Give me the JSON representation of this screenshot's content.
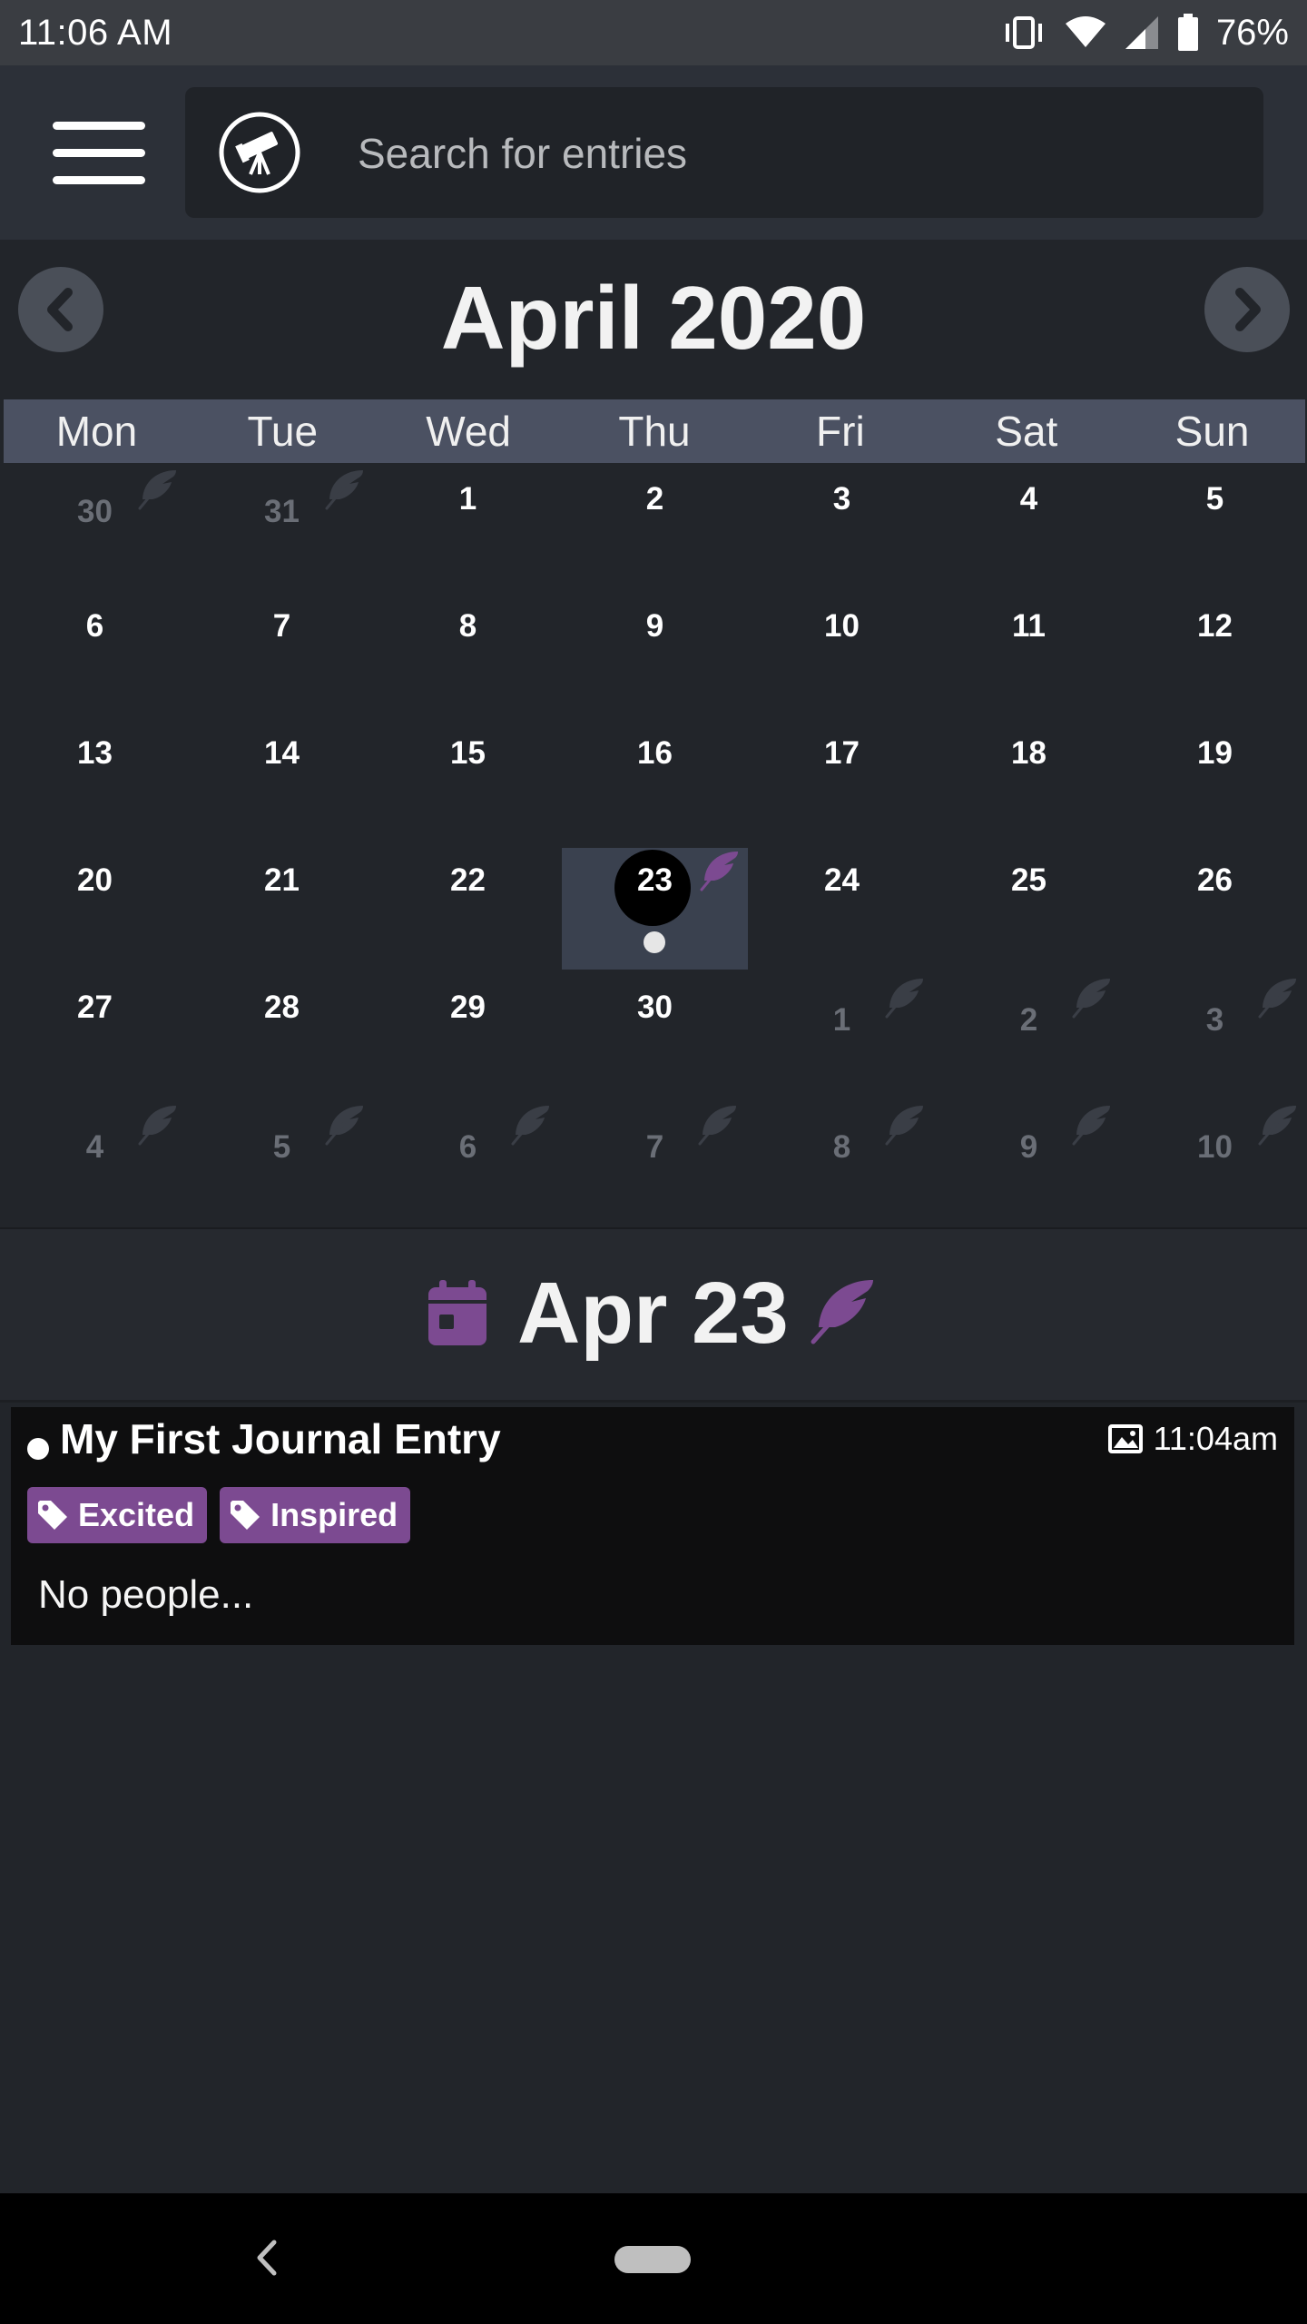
{
  "status_bar": {
    "time": "11:06 AM",
    "battery": "76%"
  },
  "search": {
    "placeholder": "Search for entries"
  },
  "calendar": {
    "month_title": "April 2020",
    "weekdays": [
      "Mon",
      "Tue",
      "Wed",
      "Thu",
      "Fri",
      "Sat",
      "Sun"
    ],
    "weeks": [
      [
        "30",
        "31",
        "1",
        "2",
        "3",
        "4",
        "5"
      ],
      [
        "6",
        "7",
        "8",
        "9",
        "10",
        "11",
        "12"
      ],
      [
        "13",
        "14",
        "15",
        "16",
        "17",
        "18",
        "19"
      ],
      [
        "20",
        "21",
        "22",
        "23",
        "24",
        "25",
        "26"
      ],
      [
        "27",
        "28",
        "29",
        "30",
        "1",
        "2",
        "3"
      ],
      [
        "4",
        "5",
        "6",
        "7",
        "8",
        "9",
        "10"
      ]
    ],
    "other_month": [
      [
        true,
        true,
        false,
        false,
        false,
        false,
        false
      ],
      [
        false,
        false,
        false,
        false,
        false,
        false,
        false
      ],
      [
        false,
        false,
        false,
        false,
        false,
        false,
        false
      ],
      [
        false,
        false,
        false,
        false,
        false,
        false,
        false
      ],
      [
        false,
        false,
        false,
        false,
        true,
        true,
        true
      ],
      [
        true,
        true,
        true,
        true,
        true,
        true,
        true
      ]
    ],
    "selected_day": "23"
  },
  "day_view": {
    "title": "Apr 23"
  },
  "entry": {
    "title": "My First Journal Entry",
    "time": "11:04am",
    "tags": [
      "Excited",
      "Inspired"
    ],
    "people_text": "No people..."
  },
  "colors": {
    "accent": "#7c4a91",
    "background": "#22252a",
    "weekday_bar": "#4b5162"
  }
}
